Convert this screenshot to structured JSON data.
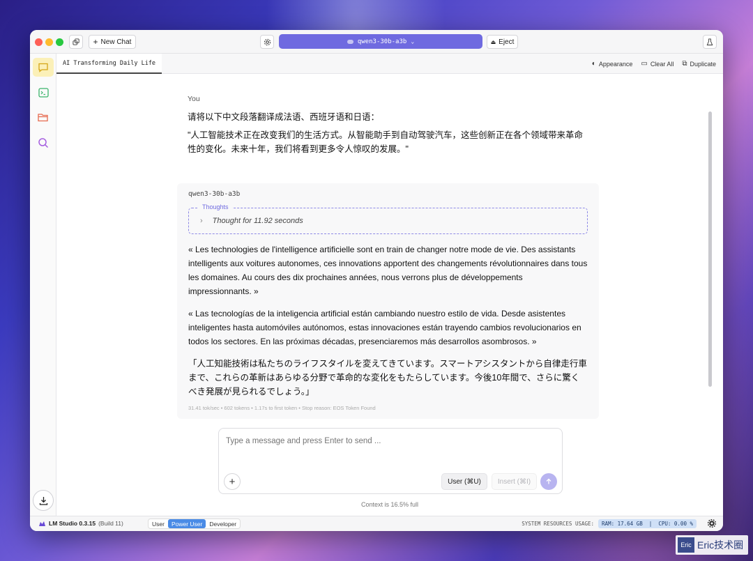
{
  "titlebar": {
    "new_chat_label": "New Chat",
    "model": "qwen3-30b-a3b",
    "eject_label": "Eject"
  },
  "tab": {
    "title": "AI Transforming Daily Life"
  },
  "top_actions": {
    "appearance": "Appearance",
    "clear_all": "Clear All",
    "duplicate": "Duplicate"
  },
  "user_message": {
    "label": "You",
    "line1": "请将以下中文段落翻译成法语、西班牙语和日语：",
    "line2": "\"人工智能技术正在改变我们的生活方式。从智能助手到自动驾驶汽车，这些创新正在各个领域带来革命性的变化。未来十年，我们将看到更多令人惊叹的发展。\""
  },
  "assistant_message": {
    "model": "qwen3-30b-a3b",
    "thoughts_label": "Thoughts",
    "thought_summary": "Thought for 11.92 seconds",
    "french": "« Les technologies de l'intelligence artificielle sont en train de changer notre mode de vie. Des assistants intelligents aux voitures autonomes, ces innovations apportent des changements révolutionnaires dans tous les domaines. Au cours des dix prochaines années, nous verrons plus de développements impressionnants. »",
    "spanish": "« Las tecnologías de la inteligencia artificial están cambiando nuestro estilo de vida. Desde asistentes inteligentes hasta automóviles autónomos, estas innovaciones están trayendo cambios revolucionarios en todos los sectores. En las próximas décadas, presenciaremos más desarrollos asombrosos. »",
    "japanese": "「人工知能技術は私たちのライフスタイルを変えてきています。スマートアシスタントから自律走行車まで、これらの革新はあらゆる分野で革命的な変化をもたらしています。今後10年間で、さらに驚くべき発展が見られるでしょう。」",
    "stats": "31.41 tok/sec  •  602 tokens  •  1.17s to first token  •  Stop reason: EOS Token Found"
  },
  "composer": {
    "placeholder": "Type a message and press Enter to send ...",
    "user_role": "User (⌘U)",
    "insert_role": "Insert (⌘I)",
    "context": "Context is 16.5% full"
  },
  "status_bar": {
    "app_name": "LM Studio 0.3.15",
    "build": "(Build 11)",
    "modes": [
      "User",
      "Power User",
      "Developer"
    ],
    "active_mode": "Power User",
    "sys_label": "SYSTEM RESOURCES USAGE:",
    "resources": "RAM: 17.64 GB  |  CPU: 0.00 %"
  },
  "watermark": {
    "badge": "Eric",
    "text": "Eric技术圈"
  },
  "colors": {
    "accent": "#6f6ae0",
    "active_mode": "#4a8be6",
    "rail_active": "#fbf0b8"
  }
}
